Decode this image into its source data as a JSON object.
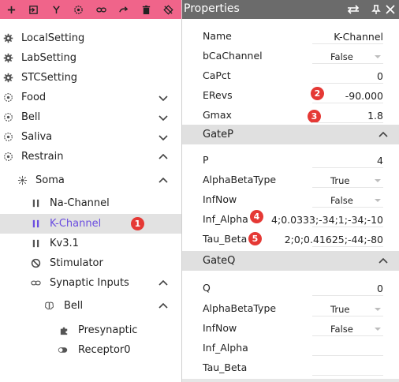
{
  "toolbar": {
    "buttons": [
      {
        "icon": "plus-icon"
      },
      {
        "icon": "import-icon"
      },
      {
        "icon": "fork-icon"
      },
      {
        "icon": "target-icon"
      },
      {
        "icon": "link-icon"
      },
      {
        "icon": "redo-icon"
      },
      {
        "icon": "trash-icon"
      },
      {
        "icon": "clear-icon"
      }
    ],
    "color": "#f0648a"
  },
  "tree": {
    "items": [
      {
        "label": "LocalSetting",
        "icon": "gear-icon",
        "chevron": "none"
      },
      {
        "label": "LabSetting",
        "icon": "gear-icon",
        "chevron": "none"
      },
      {
        "label": "STCSetting",
        "icon": "gear-icon",
        "chevron": "none"
      },
      {
        "label": "Food",
        "icon": "target-icon",
        "chevron": "down"
      },
      {
        "label": "Bell",
        "icon": "target-icon",
        "chevron": "down"
      },
      {
        "label": "Saliva",
        "icon": "target-icon",
        "chevron": "down"
      },
      {
        "label": "Restrain",
        "icon": "target-icon",
        "chevron": "up"
      },
      {
        "label": "Soma",
        "icon": "soma-icon",
        "chevron": "up"
      },
      {
        "label": "Na-Channel",
        "icon": "pause-icon",
        "chevron": "none"
      },
      {
        "label": "K-Channel",
        "icon": "pause-icon",
        "chevron": "none",
        "selected": true,
        "badge": "1"
      },
      {
        "label": "Kv3.1",
        "icon": "pause-icon",
        "chevron": "none"
      },
      {
        "label": "Stimulator",
        "icon": "block-icon",
        "chevron": "none"
      },
      {
        "label": "Synaptic Inputs",
        "icon": "link-icon",
        "chevron": "up"
      },
      {
        "label": "Bell",
        "icon": "brain-icon",
        "chevron": "up"
      },
      {
        "label": "Presynaptic",
        "icon": "puzzle-icon",
        "chevron": "none"
      },
      {
        "label": "Receptor0",
        "icon": "toggle-icon",
        "chevron": "none"
      }
    ],
    "selected_color": "#6a4de0"
  },
  "properties": {
    "title": "Properties",
    "main": [
      {
        "name": "Name",
        "value": "K-Channel",
        "type": "text"
      },
      {
        "name": "bCaChannel",
        "value": "False",
        "type": "select"
      },
      {
        "name": "CaPct",
        "value": "0",
        "type": "text"
      },
      {
        "name": "ERevs",
        "value": "-90.000",
        "type": "text",
        "badge": "2"
      },
      {
        "name": "Gmax",
        "value": "1.8",
        "type": "text",
        "badge": "3"
      }
    ],
    "groupP": {
      "title": "GateP",
      "rows": [
        {
          "name": "P",
          "value": "4",
          "type": "text"
        },
        {
          "name": "AlphaBetaType",
          "value": "True",
          "type": "select"
        },
        {
          "name": "InfNow",
          "value": "False",
          "type": "select"
        },
        {
          "name": "Inf_Alpha",
          "value": "4;0.0333;-34;1;-34;-10",
          "type": "text",
          "badge": "4"
        },
        {
          "name": "Tau_Beta",
          "value": "2;0;0.41625;-44;-80",
          "type": "text",
          "badge": "5"
        }
      ]
    },
    "groupQ": {
      "title": "GateQ",
      "rows": [
        {
          "name": "Q",
          "value": "0",
          "type": "text"
        },
        {
          "name": "AlphaBetaType",
          "value": "True",
          "type": "select"
        },
        {
          "name": "InfNow",
          "value": "False",
          "type": "select"
        },
        {
          "name": "Inf_Alpha",
          "value": "",
          "type": "text"
        },
        {
          "name": "Tau_Beta",
          "value": "",
          "type": "text"
        }
      ]
    }
  },
  "badge_color": "#e53935"
}
